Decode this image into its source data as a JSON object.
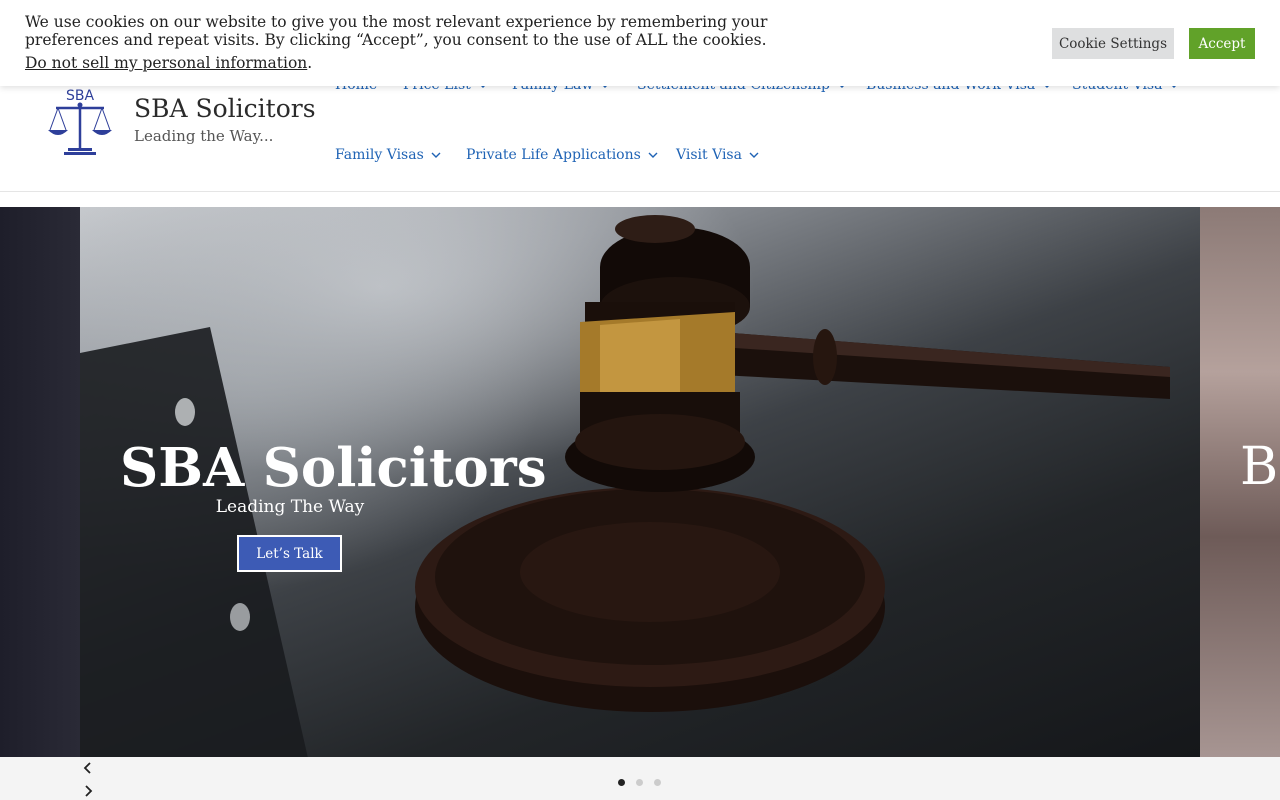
{
  "cookie": {
    "message": "We use cookies on our website to give you the most relevant experience by remembering your preferences and repeat visits. By clicking “Accept”, you consent to the use of ALL the cookies.",
    "do_not_sell": "Do not sell my personal information",
    "settings_label": "Cookie Settings",
    "accept_label": "Accept"
  },
  "brand": {
    "logo_text": "SBA",
    "title": "SBA Solicitors",
    "tagline": "Leading the Way..."
  },
  "nav": {
    "items": [
      {
        "label": "Home",
        "has_dropdown": false
      },
      {
        "label": "Price List",
        "has_dropdown": true
      },
      {
        "label": "Family Law",
        "has_dropdown": true
      },
      {
        "label": "Settlement and Citizenship",
        "has_dropdown": true
      },
      {
        "label": "Business and Work Visa",
        "has_dropdown": true
      },
      {
        "label": "Student Visa",
        "has_dropdown": true
      },
      {
        "label": "Family Visas",
        "has_dropdown": true
      },
      {
        "label": "Private Life Applications",
        "has_dropdown": true
      },
      {
        "label": "Visit Visa",
        "has_dropdown": true
      }
    ]
  },
  "hero": {
    "title": "SBA Solicitors",
    "subtitle": "Leading The Way",
    "cta_label": "Let’s Talk",
    "next_slide_title": "Be"
  },
  "slider": {
    "slide_count": 3,
    "active_index": 0
  },
  "colors": {
    "nav_link": "#1f63b5",
    "accept_button": "#61a229",
    "cta_button": "#3d5bb5",
    "logo": "#2e3f9a"
  }
}
